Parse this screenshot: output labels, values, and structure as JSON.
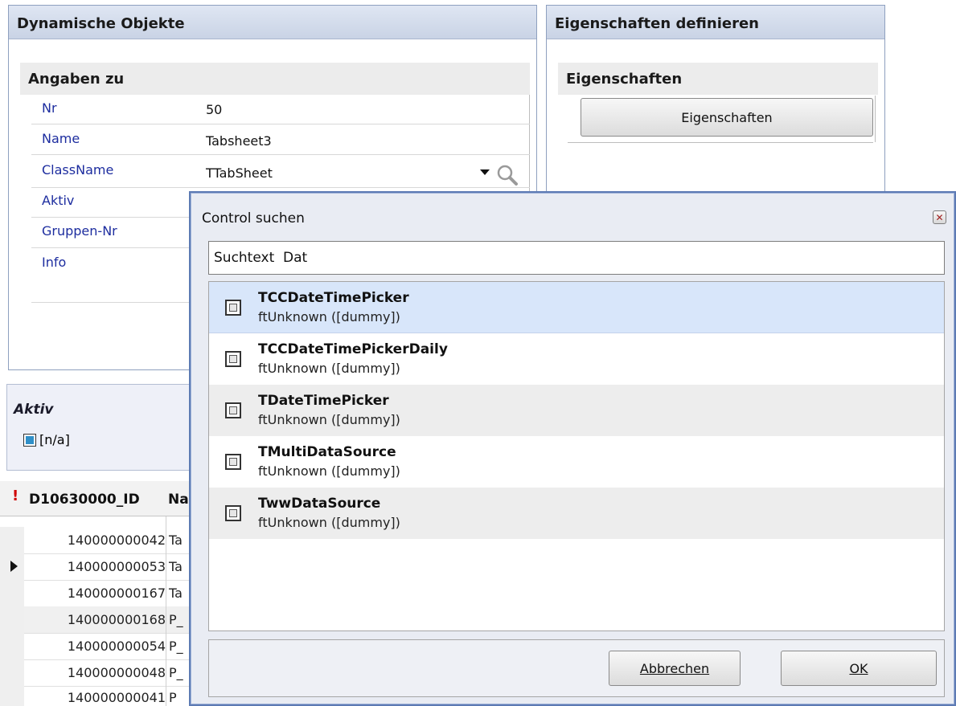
{
  "dyn_panel": {
    "title": "Dynamische Objekte",
    "section": "Angaben zu",
    "fields": [
      {
        "label": "Nr",
        "value": "50"
      },
      {
        "label": "Name",
        "value": "Tabsheet3"
      },
      {
        "label": "ClassName",
        "value": "TTabSheet"
      },
      {
        "label": "Aktiv",
        "value": ""
      },
      {
        "label": "Gruppen-Nr",
        "value": ""
      },
      {
        "label": "Info",
        "value": ""
      }
    ]
  },
  "eig_panel": {
    "title": "Eigenschaften definieren",
    "section": "Eigenschaften",
    "button": "Eigenschaften"
  },
  "filter": {
    "title": "Aktiv",
    "checkbox_label": "[n/a]"
  },
  "grid": {
    "header_id": "D10630000_ID",
    "header_name": "Na",
    "rows": [
      {
        "id": "140000000042",
        "name": "Ta"
      },
      {
        "id": "140000000053",
        "name": "Ta"
      },
      {
        "id": "140000000167",
        "name": "Ta"
      },
      {
        "id": "140000000168",
        "name": "P_"
      },
      {
        "id": "140000000054",
        "name": "P_"
      },
      {
        "id": "140000000048",
        "name": "P_"
      },
      {
        "id": "140000000041",
        "name": "P"
      }
    ]
  },
  "dialog": {
    "title": "Control suchen",
    "search_value": "Suchtext  Dat",
    "results": [
      {
        "name": "TCCDateTimePicker",
        "sub": "ftUnknown ([dummy])"
      },
      {
        "name": "TCCDateTimePickerDaily",
        "sub": "ftUnknown ([dummy])"
      },
      {
        "name": "TDateTimePicker",
        "sub": "ftUnknown ([dummy])"
      },
      {
        "name": "TMultiDataSource",
        "sub": "ftUnknown ([dummy])"
      },
      {
        "name": "TwwDataSource",
        "sub": "ftUnknown ([dummy])"
      }
    ],
    "cancel_label": "Abbrechen",
    "ok_label": "OK"
  },
  "colors": {
    "selected_row": "#d8e6fa",
    "alt_row": "#ededed",
    "label_blue": "#1d2d9f"
  }
}
